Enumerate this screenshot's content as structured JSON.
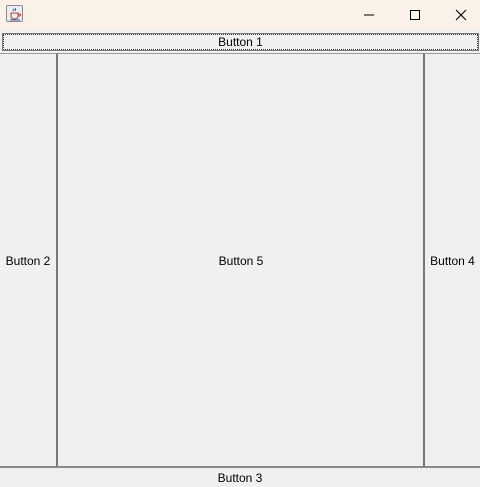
{
  "window": {
    "icon": "java-cup-icon",
    "controls": {
      "minimize": "minimize-icon",
      "maximize": "maximize-icon",
      "close": "close-icon"
    }
  },
  "buttons": {
    "north": "Button 1",
    "west": "Button 2",
    "center": "Button 5",
    "east": "Button 4",
    "south": "Button 3"
  },
  "colors": {
    "titlebar": "#faf1e8",
    "button_face": "#f0f0f0",
    "border": "#767676"
  }
}
